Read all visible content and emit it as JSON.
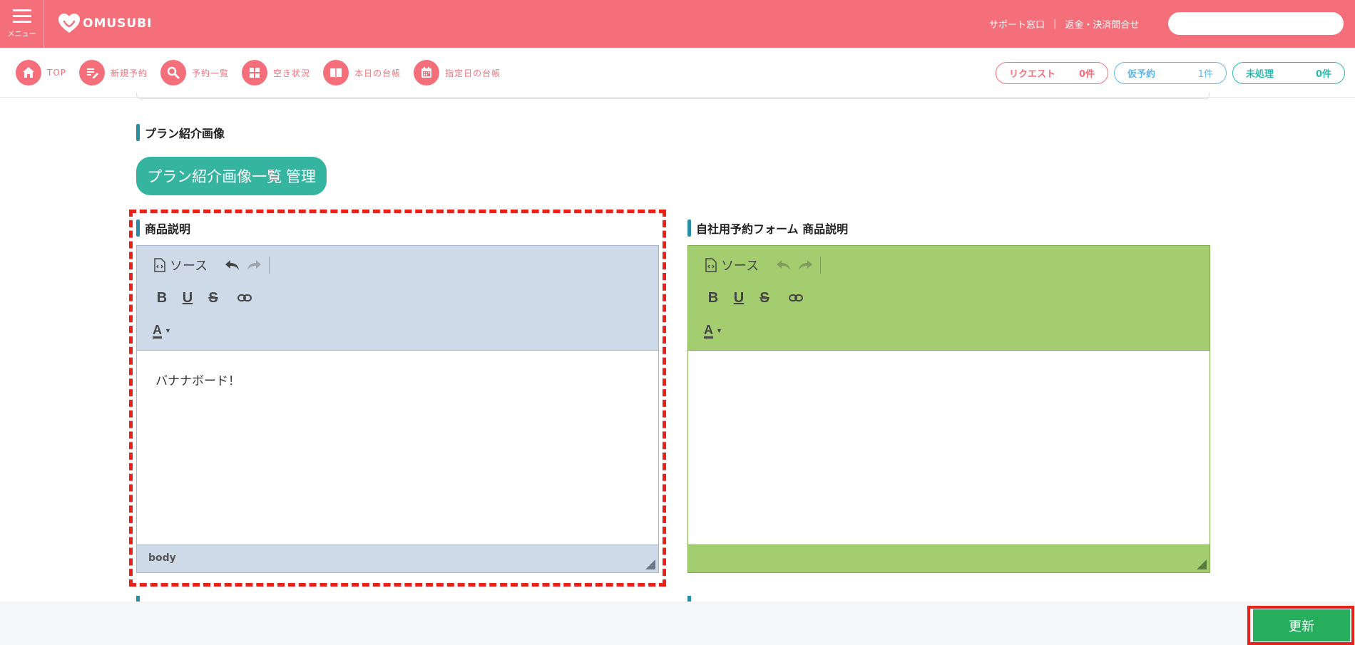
{
  "header": {
    "menu_label": "メニュー",
    "logo_text": "OMUSUBI",
    "support_link": "サポート窓口",
    "separator": "|",
    "refund_link": "返金・決済問合せ",
    "search_placeholder": ""
  },
  "nav": {
    "items": [
      {
        "label": "TOP",
        "icon": "home-icon"
      },
      {
        "label": "新規予約",
        "icon": "edit-icon"
      },
      {
        "label": "予約一覧",
        "icon": "search-icon"
      },
      {
        "label": "空き状況",
        "icon": "grid-icon"
      },
      {
        "label": "本日の台帳",
        "icon": "book-icon"
      },
      {
        "label": "指定日の台帳",
        "icon": "calendar-icon"
      }
    ],
    "counters": {
      "request": {
        "label": "リクエスト",
        "count": "0件"
      },
      "tentative": {
        "label": "仮予約",
        "count": "1件"
      },
      "unprocessed": {
        "label": "未処理",
        "count": "0件"
      }
    }
  },
  "content": {
    "plan_image_title": "プラン紹介画像",
    "plan_image_button": "プラン紹介画像一覧 管理",
    "product_desc_title": "商品説明",
    "own_form_title": "自社用予約フォーム 商品説明",
    "editor_left": {
      "source_label": "ソース",
      "bold": "B",
      "underline": "U",
      "strike": "S",
      "color": "A",
      "body_text": "バナナボード！",
      "status_path": "body"
    },
    "editor_right": {
      "source_label": "ソース",
      "bold": "B",
      "underline": "U",
      "strike": "S",
      "color": "A",
      "body_text": "",
      "status_path": ""
    }
  },
  "footer": {
    "update_button": "更新"
  },
  "colors": {
    "brand": "#f56f7b",
    "teal": "#35b4a0",
    "editor_blue": "#cfdae9",
    "editor_green": "#a4cd70",
    "update_green": "#27ae5d",
    "highlight_red": "#e8211b"
  }
}
